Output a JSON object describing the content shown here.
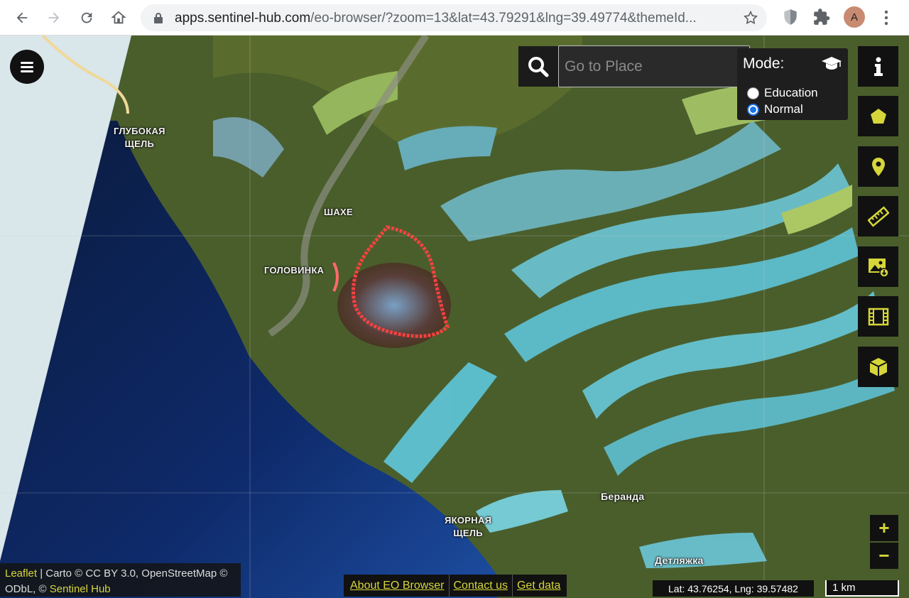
{
  "browser": {
    "url_host": "apps.sentinel-hub.com",
    "url_path": "/eo-browser/?zoom=13&lat=43.79291&lng=39.49774&themeId...",
    "avatar_letter": "A",
    "icons": [
      "back-icon",
      "forward-icon",
      "reload-icon",
      "home-icon",
      "lock-icon",
      "star-icon",
      "shield-icon",
      "puzzle-icon",
      "kebab-menu-icon"
    ]
  },
  "map": {
    "labels": {
      "glubokaya_line1": "ГЛУБОКАЯ",
      "glubokaya_line2": "ЩЕЛЬ",
      "shakhe": "ШАХЕ",
      "golovinka": "ГОЛОВИНКА",
      "yakornaya_line1": "ЯКОРНАЯ",
      "yakornaya_line2": "ЩЕЛЬ",
      "beranda": "Беранда",
      "detlyazhka": "Детляжка"
    }
  },
  "search": {
    "placeholder": "Go to Place"
  },
  "mode": {
    "title": "Mode:",
    "options": [
      {
        "label": "Education",
        "selected": false
      },
      {
        "label": "Normal",
        "selected": true
      }
    ]
  },
  "toolbar": {
    "accent_color": "#d6d63b",
    "buttons": [
      "info-icon",
      "polygon-icon",
      "pin-icon",
      "ruler-icon",
      "image-download-icon",
      "film-icon",
      "cube-icon"
    ]
  },
  "zoom": {
    "in_label": "+",
    "out_label": "−"
  },
  "attribution": {
    "leaflet": "Leaflet",
    "text1": " | Carto © CC BY 3.0, OpenStreetMap ©",
    "text2": "ODbL, © ",
    "sentinel": "Sentinel Hub"
  },
  "footer": {
    "about": "About EO Browser",
    "contact": "Contact us",
    "get_data": "Get data"
  },
  "coords": {
    "text": "Lat: 43.76254, Lng: 39.57482"
  },
  "scale": {
    "label": "1 km"
  }
}
